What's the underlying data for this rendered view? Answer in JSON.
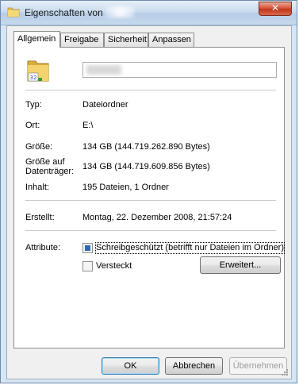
{
  "window": {
    "title": "Eigenschaften von",
    "close_label": "✕"
  },
  "tabs": [
    {
      "label": "Allgemein",
      "active": true
    },
    {
      "label": "Freigabe",
      "active": false
    },
    {
      "label": "Sicherheit",
      "active": false
    },
    {
      "label": "Anpassen",
      "active": false
    }
  ],
  "general": {
    "name_value": "",
    "icon": "folder-icon",
    "fields": {
      "type": {
        "label": "Typ:",
        "value": "Dateiordner"
      },
      "location": {
        "label": "Ort:",
        "value": "E:\\"
      },
      "size": {
        "label": "Größe:",
        "value": "134 GB (144.719.262.890 Bytes)"
      },
      "size_on_disk": {
        "label": "Größe auf Datenträger:",
        "value": "134 GB (144.719.609.856 Bytes)"
      },
      "contents": {
        "label": "Inhalt:",
        "value": "195 Dateien, 1 Ordner"
      },
      "created": {
        "label": "Erstellt:",
        "value": "Montag, 22. Dezember 2008, 21:57:24"
      }
    },
    "attributes": {
      "label": "Attribute:",
      "readonly": {
        "label": "Schreibgeschützt (betrifft nur Dateien im Ordner)",
        "checked": true
      },
      "hidden": {
        "label": "Versteckt",
        "checked": false
      },
      "advanced_button": "Erweitert..."
    }
  },
  "footer": {
    "ok": "OK",
    "cancel": "Abbrechen",
    "apply": "Übernehmen"
  },
  "colors": {
    "accent": "#2c6bb3",
    "title_gradient_top": "#e5eef8",
    "close_red": "#c1381c"
  }
}
